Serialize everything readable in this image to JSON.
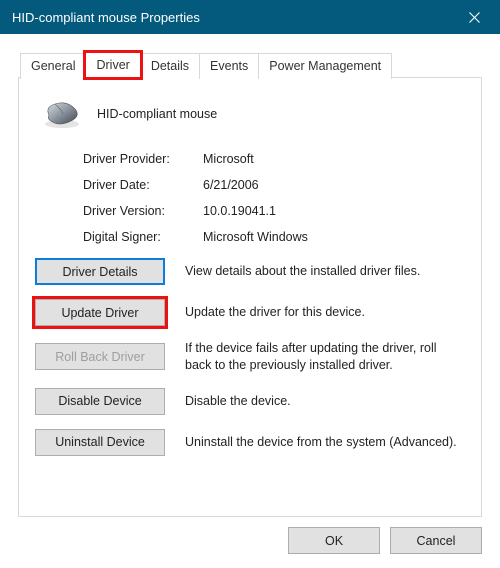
{
  "window": {
    "title": "HID-compliant mouse Properties"
  },
  "tabs": {
    "general": "General",
    "driver": "Driver",
    "details": "Details",
    "events": "Events",
    "power": "Power Management"
  },
  "device": {
    "name": "HID-compliant mouse"
  },
  "info": {
    "provider_label": "Driver Provider:",
    "provider_value": "Microsoft",
    "date_label": "Driver Date:",
    "date_value": "6/21/2006",
    "version_label": "Driver Version:",
    "version_value": "10.0.19041.1",
    "signer_label": "Digital Signer:",
    "signer_value": "Microsoft Windows"
  },
  "buttons": {
    "details": {
      "label": "Driver Details",
      "desc": "View details about the installed driver files."
    },
    "update": {
      "label": "Update Driver",
      "desc": "Update the driver for this device."
    },
    "rollback": {
      "label": "Roll Back Driver",
      "desc": "If the device fails after updating the driver, roll back to the previously installed driver."
    },
    "disable": {
      "label": "Disable Device",
      "desc": "Disable the device."
    },
    "uninstall": {
      "label": "Uninstall Device",
      "desc": "Uninstall the device from the system (Advanced)."
    }
  },
  "footer": {
    "ok": "OK",
    "cancel": "Cancel"
  }
}
